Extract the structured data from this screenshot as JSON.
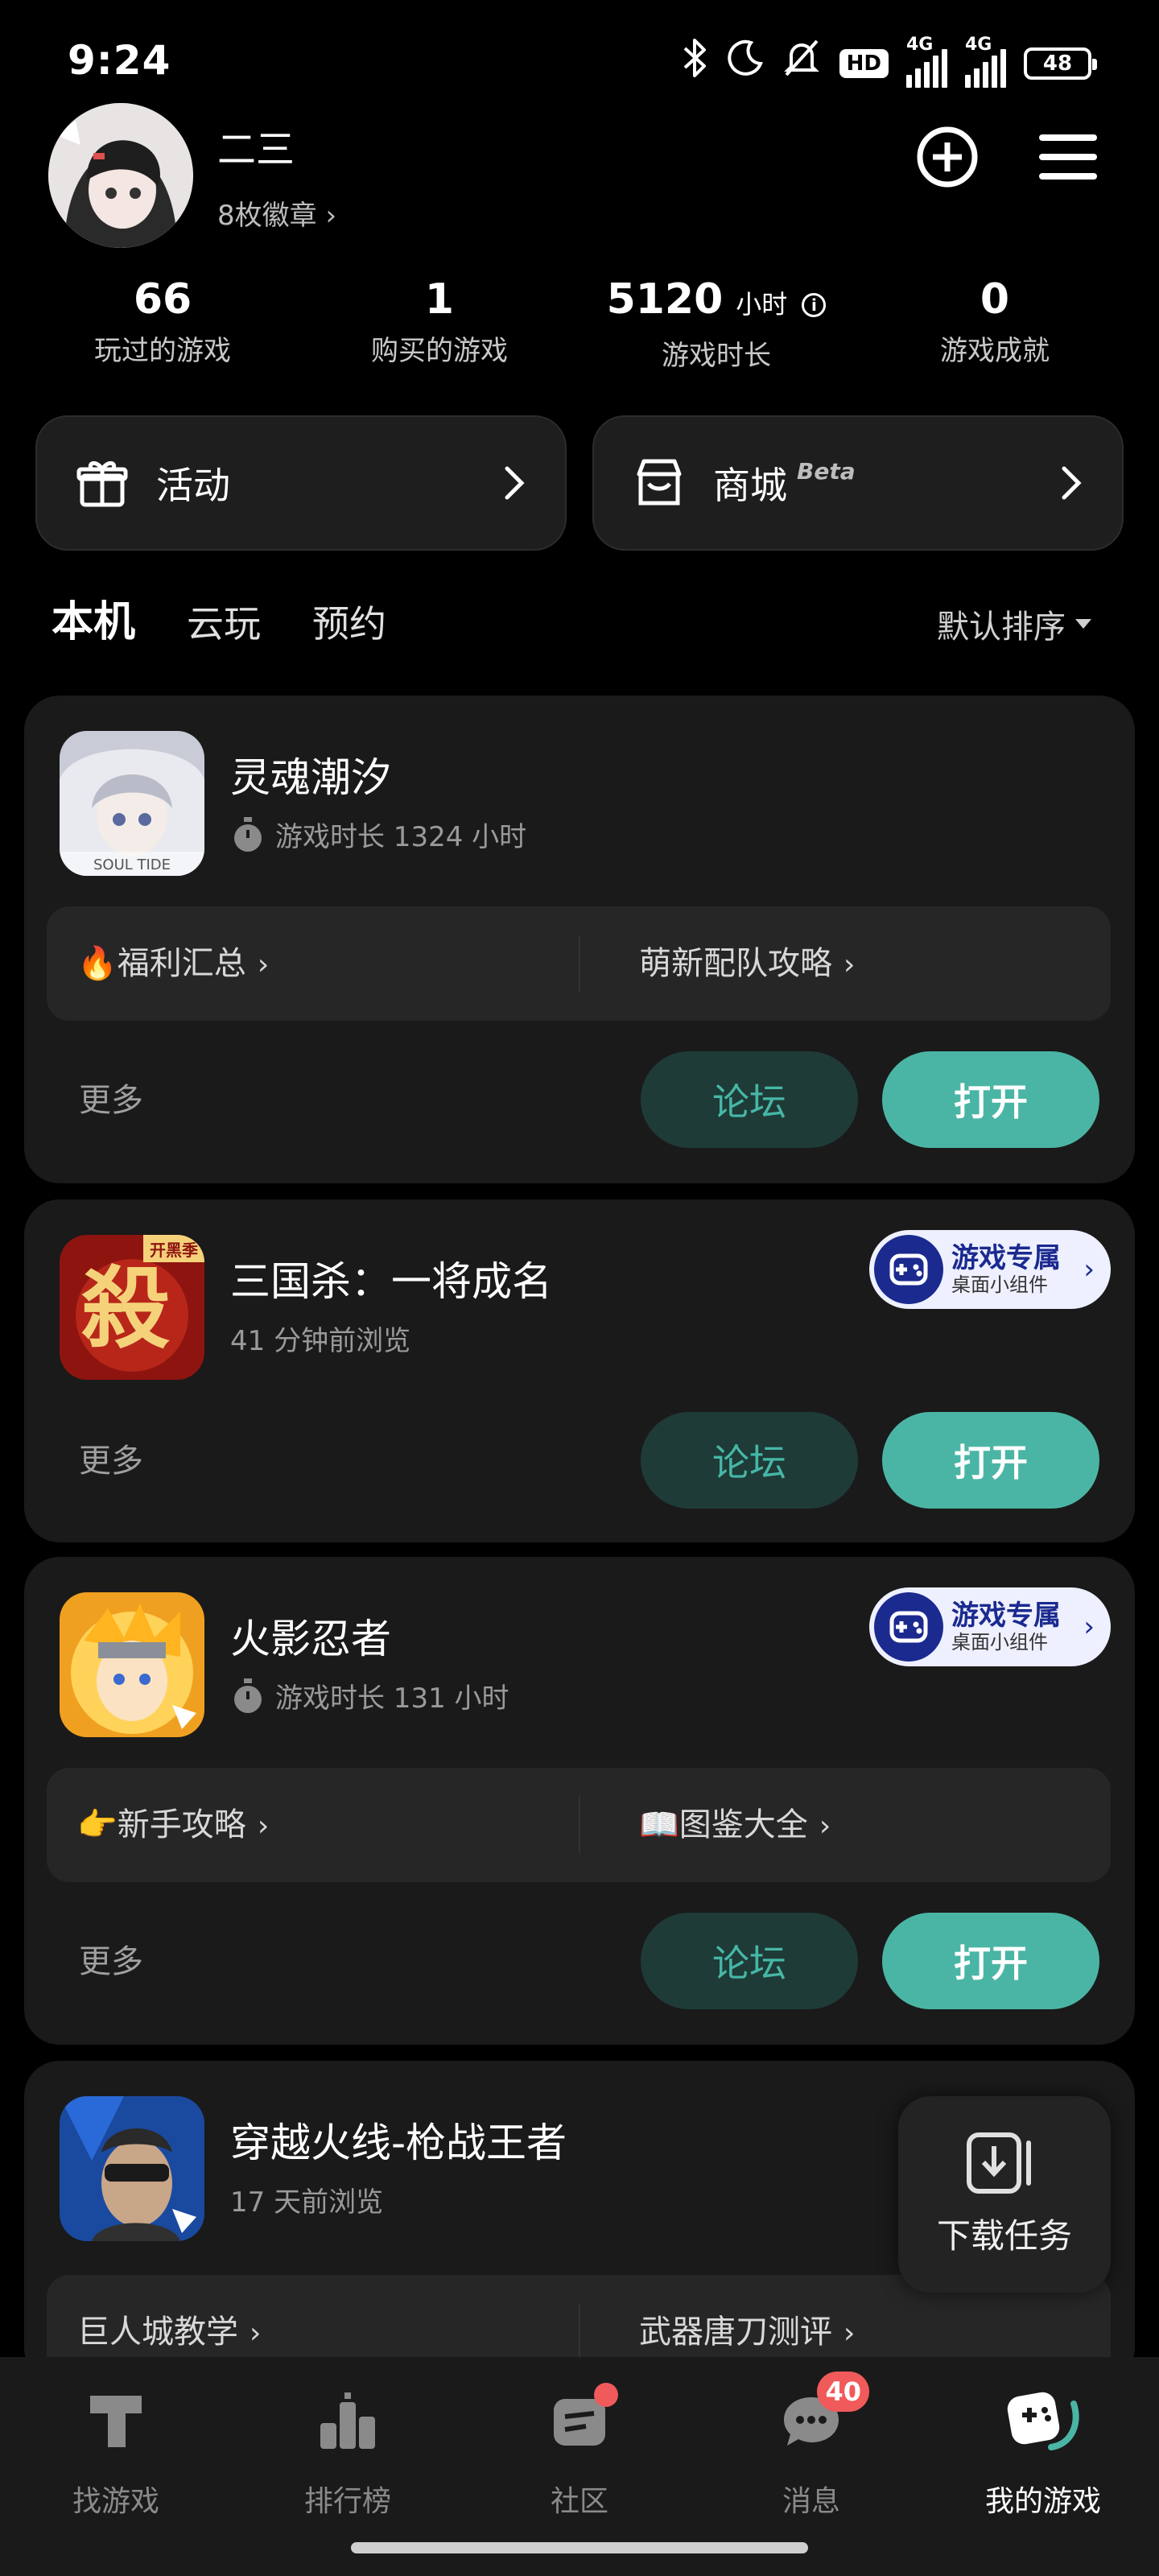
{
  "status_bar": {
    "time": "9:24",
    "network1": "4G",
    "network2": "4G",
    "battery": "48",
    "hd_label": "HD"
  },
  "profile": {
    "name": "二三",
    "badges": "8枚徽章 ›"
  },
  "stats": [
    {
      "value": "66",
      "label": "玩过的游戏"
    },
    {
      "value": "1",
      "label": "购买的游戏"
    },
    {
      "value": "5120",
      "unit": "小时",
      "label": "游戏时长"
    },
    {
      "value": "0",
      "label": "游戏成就"
    }
  ],
  "quick": {
    "activity": "活动",
    "store": "商城",
    "store_tag": "Beta"
  },
  "tabs": {
    "local": "本机",
    "cloud": "云玩",
    "reserve": "预约",
    "sort": "默认排序"
  },
  "games": [
    {
      "title": "灵魂潮汐",
      "subtitle": "游戏时长 1324 小时",
      "link_left": "🔥福利汇总",
      "link_right": "萌新配队攻略",
      "more": "更多",
      "forum": "论坛",
      "open": "打开",
      "icon_caption": "SOUL TIDE"
    },
    {
      "title": "三国杀：一将成名",
      "subtitle": "41 分钟前浏览",
      "more": "更多",
      "forum": "论坛",
      "open": "打开",
      "widget_line1": "游戏专属",
      "widget_line2": "桌面小组件",
      "icon_text": "殺",
      "icon_tag": "开黑季"
    },
    {
      "title": "火影忍者",
      "subtitle": "游戏时长 131 小时",
      "link_left": "👉新手攻略",
      "link_right": "📖图鉴大全",
      "more": "更多",
      "forum": "论坛",
      "open": "打开",
      "widget_line1": "游戏专属",
      "widget_line2": "桌面小组件"
    },
    {
      "title": "穿越火线-枪战王者",
      "subtitle": "17 天前浏览",
      "link_left": "巨人城教学",
      "link_right": "武器唐刀测评"
    }
  ],
  "download": {
    "label": "下载任务"
  },
  "nav": [
    {
      "label": "找游戏",
      "icon": "find-game-icon"
    },
    {
      "label": "排行榜",
      "icon": "rank-icon"
    },
    {
      "label": "社区",
      "icon": "community-icon"
    },
    {
      "label": "消息",
      "icon": "message-icon",
      "badge": "40"
    },
    {
      "label": "我的游戏",
      "icon": "my-game-icon"
    }
  ],
  "colors": {
    "accent": "#4bb5a5",
    "card": "#1a1a1a",
    "badge": "#f05a5a"
  }
}
